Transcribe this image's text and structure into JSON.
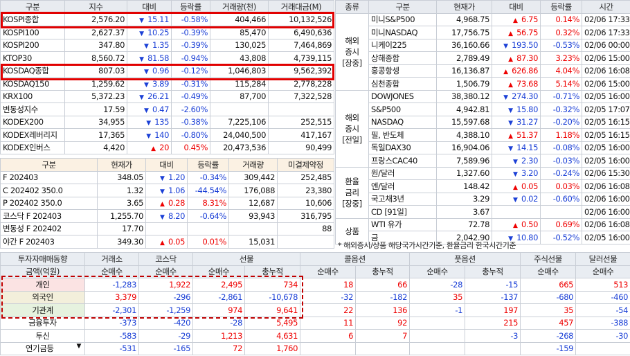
{
  "index_table": {
    "headers": [
      "구분",
      "지수",
      "대비",
      "등락률",
      "거래량(천)",
      "거래대금(M)"
    ],
    "rows": [
      {
        "name": "KOSPI종합",
        "value": "2,576.20",
        "dir": "down",
        "change": "15.11",
        "rate": "-0.58%",
        "volume": "404,466",
        "amount": "10,132,526"
      },
      {
        "name": "KOSPI100",
        "value": "2,627.37",
        "dir": "down",
        "change": "10.25",
        "rate": "-0.39%",
        "volume": "85,470",
        "amount": "6,490,636"
      },
      {
        "name": "KOSPI200",
        "value": "347.80",
        "dir": "down",
        "change": "1.35",
        "rate": "-0.39%",
        "volume": "130,025",
        "amount": "7,464,869"
      },
      {
        "name": "KTOP30",
        "value": "8,560.72",
        "dir": "down",
        "change": "81.58",
        "rate": "-0.94%",
        "volume": "43,808",
        "amount": "4,739,115"
      },
      {
        "name": "KOSDAQ종합",
        "value": "807.03",
        "dir": "down",
        "change": "0.96",
        "rate": "-0.12%",
        "volume": "1,046,803",
        "amount": "9,562,392"
      },
      {
        "name": "KOSDAQ150",
        "value": "1,259.62",
        "dir": "down",
        "change": "3.89",
        "rate": "-0.31%",
        "volume": "115,284",
        "amount": "2,778,228"
      },
      {
        "name": "KRX100",
        "value": "5,372.23",
        "dir": "down",
        "change": "26.21",
        "rate": "-0.49%",
        "volume": "87,700",
        "amount": "7,322,528"
      },
      {
        "name": "변동성지수",
        "value": "17.59",
        "dir": "down",
        "change": "0.47",
        "rate": "-2.60%",
        "volume": "",
        "amount": ""
      },
      {
        "name": "KODEX200",
        "value": "34,955",
        "dir": "down",
        "change": "135",
        "rate": "-0.38%",
        "volume": "7,225,106",
        "amount": "252,515"
      },
      {
        "name": "KODEX레버리지",
        "value": "17,365",
        "dir": "down",
        "change": "140",
        "rate": "-0.80%",
        "volume": "24,040,500",
        "amount": "417,167"
      },
      {
        "name": "KODEX인버스",
        "value": "4,420",
        "dir": "up",
        "change": "20",
        "rate": "0.45%",
        "volume": "20,473,536",
        "amount": "90,499"
      }
    ]
  },
  "futures_table": {
    "headers": [
      "구분",
      "현재가",
      "대비",
      "등락률",
      "거래량",
      "미결제약정"
    ],
    "rows": [
      {
        "name": "F 202403",
        "value": "348.05",
        "dir": "down",
        "change": "1.20",
        "rate": "-0.34%",
        "volume": "309,442",
        "oi": "252,485"
      },
      {
        "name": "C 202402 350.0",
        "value": "1.32",
        "dir": "down",
        "change": "1.06",
        "rate": "-44.54%",
        "volume": "176,088",
        "oi": "23,380"
      },
      {
        "name": "P 202402 350.0",
        "value": "3.65",
        "dir": "up",
        "change": "0.28",
        "rate": "8.31%",
        "volume": "12,687",
        "oi": "10,606"
      },
      {
        "name": "코스닥 F 202403",
        "value": "1,255.70",
        "dir": "down",
        "change": "8.20",
        "rate": "-0.64%",
        "volume": "93,943",
        "oi": "316,795"
      },
      {
        "name": "변동성 F 202402",
        "value": "17.70",
        "dir": "",
        "change": "",
        "rate": "",
        "volume": "",
        "oi": "88"
      },
      {
        "name": "야간 F 202403",
        "value": "349.30",
        "dir": "up",
        "change": "0.05",
        "rate": "0.01%",
        "volume": "15,031",
        "oi": ""
      }
    ]
  },
  "world_table": {
    "headers": [
      "종류",
      "구분",
      "현재가",
      "대비",
      "등락률",
      "시간"
    ],
    "groups": [
      {
        "label": [
          "해외",
          "증시",
          "[장중]"
        ],
        "rows": [
          {
            "name": "미니S&P500",
            "value": "4,968.75",
            "dir": "up",
            "change": "6.75",
            "rate": "0.14%",
            "time": "02/06 17:33"
          },
          {
            "name": "미니NASDAQ",
            "value": "17,756.75",
            "dir": "up",
            "change": "56.75",
            "rate": "0.32%",
            "time": "02/06 17:33"
          },
          {
            "name": "니케이225",
            "value": "36,160.66",
            "dir": "down",
            "change": "193.50",
            "rate": "-0.53%",
            "time": "02/06 00:00"
          },
          {
            "name": "상해종합",
            "value": "2,789.49",
            "dir": "up",
            "change": "87.30",
            "rate": "3.23%",
            "time": "02/06 15:00"
          },
          {
            "name": "홍콩항셍",
            "value": "16,136.87",
            "dir": "up",
            "change": "626.86",
            "rate": "4.04%",
            "time": "02/06 16:08"
          },
          {
            "name": "심천종합",
            "value": "1,506.79",
            "dir": "up",
            "change": "73.68",
            "rate": "5.14%",
            "time": "02/06 15:00"
          }
        ]
      },
      {
        "label": [
          "해외",
          "증시",
          "[전일]"
        ],
        "rows": [
          {
            "name": "DOWJONES",
            "value": "38,380.12",
            "dir": "down",
            "change": "274.30",
            "rate": "-0.71%",
            "time": "02/05 16:00"
          },
          {
            "name": "S&P500",
            "value": "4,942.81",
            "dir": "down",
            "change": "15.80",
            "rate": "-0.32%",
            "time": "02/05 17:07"
          },
          {
            "name": "NASDAQ",
            "value": "15,597.68",
            "dir": "down",
            "change": "31.27",
            "rate": "-0.20%",
            "time": "02/05 16:15"
          },
          {
            "name": "필, 반도체",
            "value": "4,388.10",
            "dir": "up",
            "change": "51.37",
            "rate": "1.18%",
            "time": "02/05 16:15"
          },
          {
            "name": "독일DAX30",
            "value": "16,904.06",
            "dir": "down",
            "change": "14.15",
            "rate": "-0.08%",
            "time": "02/05 16:00"
          },
          {
            "name": "프랑스CAC40",
            "value": "7,589.96",
            "dir": "down",
            "change": "2.30",
            "rate": "-0.03%",
            "time": "02/05 16:00"
          }
        ]
      },
      {
        "label": [
          "환율",
          "금리",
          "[장중]"
        ],
        "rows": [
          {
            "name": "원/달러",
            "value": "1,327.60",
            "dir": "down",
            "change": "3.20",
            "rate": "-0.24%",
            "time": "02/06 15:30"
          },
          {
            "name": "엔/달러",
            "value": "148.42",
            "dir": "up",
            "change": "0.05",
            "rate": "0.03%",
            "time": "02/06 16:08"
          },
          {
            "name": "국고채3년",
            "value": "3.29",
            "dir": "down",
            "change": "0.02",
            "rate": "-0.60%",
            "time": "02/06 16:00"
          },
          {
            "name": "CD [91일]",
            "value": "3.67",
            "dir": "",
            "change": "",
            "rate": "",
            "time": "02/06 16:00"
          }
        ]
      },
      {
        "label": [
          "상품"
        ],
        "rows": [
          {
            "name": "WTI 유가",
            "value": "72.78",
            "dir": "up",
            "change": "0.50",
            "rate": "0.69%",
            "time": "02/06 16:08"
          },
          {
            "name": "금",
            "value": "2,042.90",
            "dir": "down",
            "change": "10.80",
            "rate": "-0.52%",
            "time": "02/05 16:00"
          }
        ]
      }
    ]
  },
  "note": "* 해외증시/상품 해당국가시간기준, 환율금리 한국시간기준",
  "investor_table": {
    "title": "투자자매매동향",
    "groups": [
      "거래소",
      "코스닥",
      "선물",
      "콜옵션",
      "풋옵션",
      "주식선물",
      "달러선물"
    ],
    "unit_label": "금액(억원)",
    "subheaders": [
      "순매수",
      "순매수",
      "순매수",
      "총누적",
      "순매수",
      "총누적",
      "순매수",
      "총누적",
      "순매수",
      "순매수"
    ],
    "rows": [
      {
        "name": "개인",
        "cls": "p1",
        "vals": [
          "-1,283",
          "1,922",
          "2,495",
          "734",
          "18",
          "66",
          "-28",
          "-15",
          "665",
          "513"
        ]
      },
      {
        "name": "외국인",
        "cls": "p2",
        "vals": [
          "3,379",
          "-296",
          "-2,861",
          "-10,678",
          "-32",
          "-182",
          "35",
          "-137",
          "-680",
          "-460"
        ]
      },
      {
        "name": "기관계",
        "cls": "p3",
        "vals": [
          "-2,301",
          "-1,259",
          "974",
          "9,641",
          "22",
          "136",
          "-1",
          "197",
          "35",
          "-54"
        ]
      },
      {
        "name": "금융투자",
        "cls": "",
        "vals": [
          "-373",
          "-420",
          "-28",
          "5,495",
          "11",
          "92",
          "",
          "215",
          "457",
          "-388"
        ]
      },
      {
        "name": "투신",
        "cls": "",
        "vals": [
          "-583",
          "-29",
          "1,213",
          "4,631",
          "6",
          "7",
          "",
          "-3",
          "-268",
          "-30"
        ]
      },
      {
        "name": "연기금등",
        "cls": "sel",
        "vals": [
          "-531",
          "-165",
          "72",
          "1,760",
          "",
          "",
          "",
          "",
          "-159",
          ""
        ]
      }
    ]
  },
  "colors": {
    "up": "#e00000",
    "down": "#1a3fd6",
    "highlight": "#e10000"
  }
}
